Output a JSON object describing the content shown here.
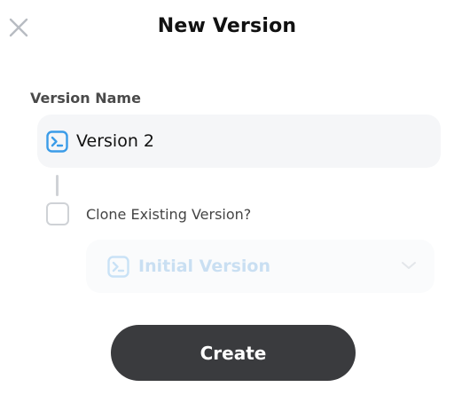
{
  "dialog": {
    "title": "New Version",
    "close_icon": "close-icon"
  },
  "version_name": {
    "label": "Version Name",
    "value": "Version 2",
    "icon": "terminal-icon",
    "icon_color": "#3b9ce8"
  },
  "clone": {
    "checked": false,
    "label": "Clone Existing Version?",
    "select": {
      "value": "Initial Version",
      "disabled": true,
      "icon": "terminal-icon",
      "chevron_icon": "chevron-down-icon"
    }
  },
  "actions": {
    "create_label": "Create",
    "create_color": "#3a3b3e"
  }
}
